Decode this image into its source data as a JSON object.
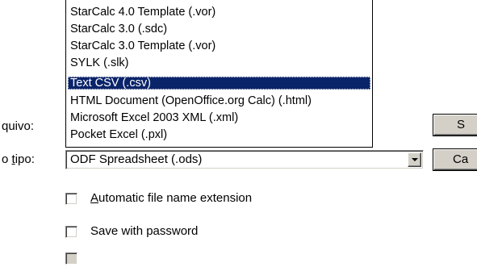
{
  "labels": {
    "filename_label": "quivo:",
    "filetype_label_prefix": "o ",
    "filetype_label_u": "t",
    "filetype_label_rest": "ipo:"
  },
  "filetype": {
    "selected_value": "ODF Spreadsheet (.ods)"
  },
  "dropdown": {
    "items": [
      "StarCalc 4.0 Template (.vor)",
      "StarCalc 3.0 (.sdc)",
      "StarCalc 3.0 Template (.vor)",
      "SYLK (.slk)",
      "Text CSV (.csv)",
      "HTML Document (OpenOffice.org Calc) (.html)",
      "Microsoft Excel 2003 XML (.xml)",
      "Pocket Excel (.pxl)"
    ],
    "selected_index": 4
  },
  "buttons": {
    "first_label": "S",
    "second_label": "Ca"
  },
  "options": {
    "auto_ext_u": "A",
    "auto_ext_rest": "utomatic file name extension",
    "save_password": "Save with password",
    "auto_ext_checked": false,
    "save_password_checked": false
  },
  "colors": {
    "selection": "#0a246a",
    "face": "#d4d0c8"
  },
  "icons": [
    "chevron-down-icon"
  ]
}
